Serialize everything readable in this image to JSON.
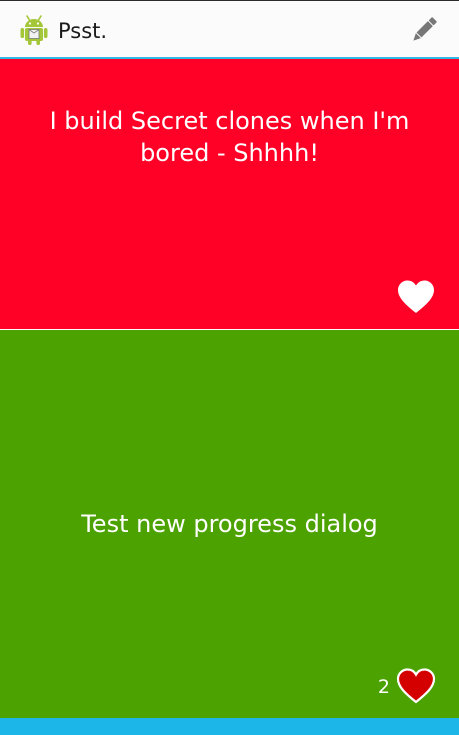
{
  "action_bar": {
    "title": "Psst.",
    "app_icon": "android-robot-icon",
    "compose_icon": "pencil-icon",
    "accent_color": "#33b5e5"
  },
  "feed": {
    "cards": [
      {
        "text": "I build Secret clones when I'm bored - Shhhh!",
        "background": "#ff0027",
        "like_count": "",
        "liked": false
      },
      {
        "text": "Test new progress dialog",
        "background": "#4ba200",
        "like_count": "2",
        "liked": true
      },
      {
        "text": "",
        "background": "#1db6e8"
      }
    ]
  }
}
